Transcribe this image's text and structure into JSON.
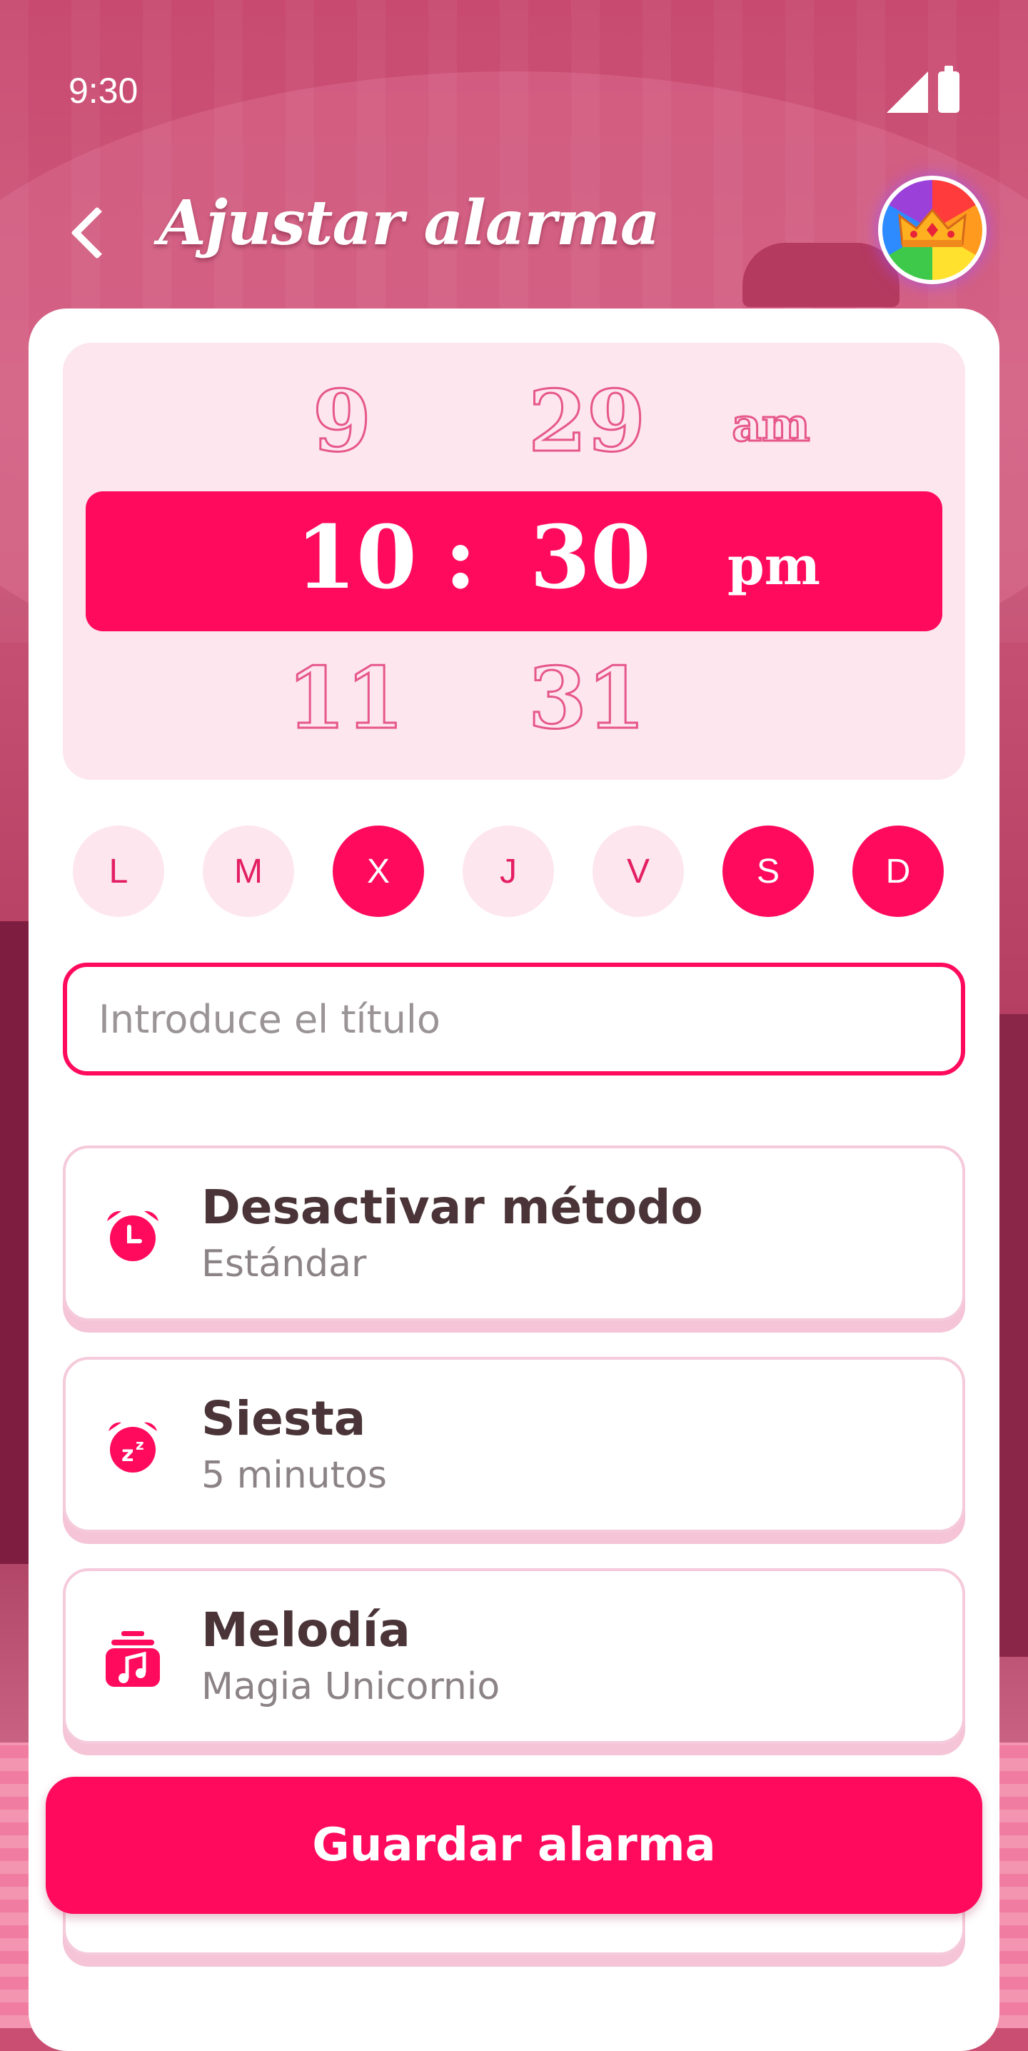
{
  "status_bar": {
    "time": "9:30"
  },
  "header": {
    "title": "Ajustar alarma"
  },
  "time_picker": {
    "hour_prev": "9",
    "minute_prev": "29",
    "ampm_prev": "am",
    "hour": "10",
    "separator": ":",
    "minute": "30",
    "ampm": "pm",
    "hour_next": "11",
    "minute_next": "31"
  },
  "days": [
    {
      "label": "L",
      "active": false
    },
    {
      "label": "M",
      "active": false
    },
    {
      "label": "X",
      "active": true
    },
    {
      "label": "J",
      "active": false
    },
    {
      "label": "V",
      "active": false
    },
    {
      "label": "S",
      "active": true
    },
    {
      "label": "D",
      "active": true
    }
  ],
  "title_input": {
    "placeholder": "Introduce el título",
    "value": ""
  },
  "options": [
    {
      "title": "Desactivar método",
      "value": "Estándar",
      "icon": "alarm-clock-icon"
    },
    {
      "title": "Siesta",
      "value": "5 minutos",
      "icon": "snooze-icon"
    },
    {
      "title": "Melodía",
      "value": "Magia Unicornio",
      "icon": "music-note-icon"
    }
  ],
  "save_button": {
    "label": "Guardar alarma"
  },
  "colors": {
    "accent": "#ff0a5c",
    "picker_bg": "#fde6ee",
    "text_dark": "#4a3438",
    "text_muted": "#8c8386"
  }
}
